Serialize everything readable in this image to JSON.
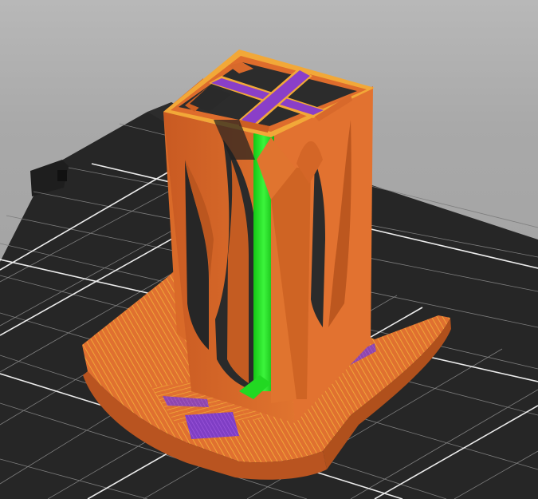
{
  "viewport": {
    "type": "3d-slicer-preview",
    "background_color": "#aaaaaa",
    "bed_color": "#232323",
    "grid_color": "#8a8a8a",
    "grid_major_color": "#f2f2f2"
  },
  "model": {
    "feature_colors": {
      "perimeter": "#e06d2e",
      "external_perimeter": "#f0a030",
      "solid_infill": "#8a3fc8",
      "internal_infill": "#1ee61e"
    }
  }
}
